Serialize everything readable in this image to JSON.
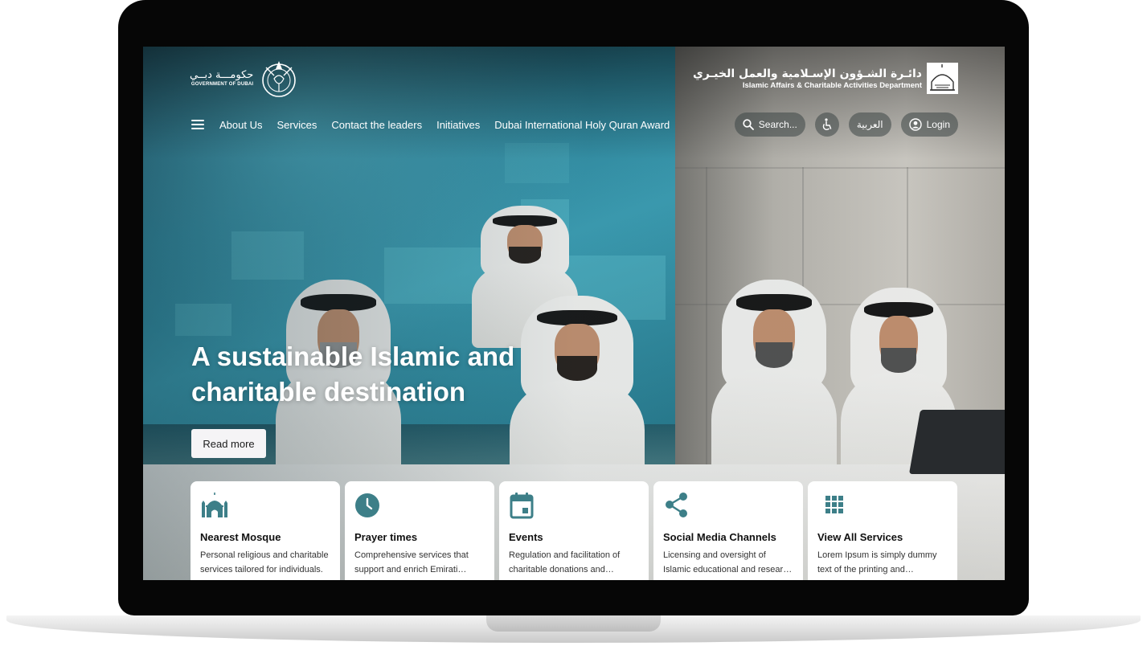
{
  "header": {
    "gov_logo": {
      "arabic": "حكومـــة دبــي",
      "english": "GOVERNMENT OF DUBAI"
    },
    "dept_logo": {
      "arabic": "دائـرة الشـؤون الإسـلامية والعمل الخيـري",
      "english": "Islamic Affairs & Charitable Activities Department"
    }
  },
  "nav": {
    "items": [
      "About Us",
      "Services",
      "Contact the leaders",
      "Initiatives",
      "Dubai International Holy Quran Award"
    ]
  },
  "utility": {
    "search_label": "Search...",
    "language_label": "العربية",
    "login_label": "Login"
  },
  "hero": {
    "title": "A sustainable Islamic and charitable destination",
    "cta_label": "Read more"
  },
  "cards": [
    {
      "title": "Nearest Mosque",
      "description": "Personal religious and charitable services tailored for individuals.",
      "icon": "mosque-icon"
    },
    {
      "title": "Prayer times",
      "description": "Comprehensive services that support and enrich Emirati families.",
      "icon": "clock-icon"
    },
    {
      "title": "Events",
      "description": "Regulation and facilitation of charitable donations and initiatives.",
      "icon": "calendar-icon"
    },
    {
      "title": "Social Media Channels",
      "description": "Licensing and oversight of Islamic educational and research centers.",
      "icon": "share-icon"
    },
    {
      "title": "View All Services",
      "description": "Lorem Ipsum is simply dummy text of the printing and typesetting industry.",
      "icon": "grid-icon"
    }
  ],
  "colors": {
    "accent": "#3d7f88",
    "card_bg": "#ffffff",
    "button_bg": "#f5f4f6"
  }
}
